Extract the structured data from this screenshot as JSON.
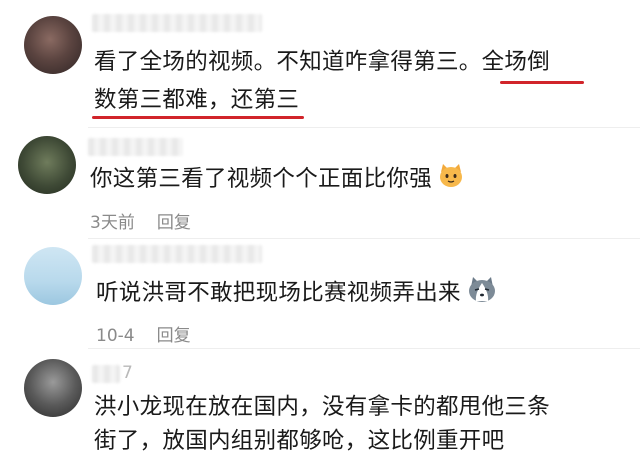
{
  "comments": [
    {
      "line1": "看了全场的视频。不知道咋拿得第三。全场倒",
      "line2": "数第三都难，还第三"
    },
    {
      "line1": "你这第三看了视频个个正面比你强",
      "emoji": "cat-face-emoji",
      "time": "3天前",
      "reply": "回复"
    },
    {
      "line1": "听说洪哥不敢把现场比赛视频弄出来",
      "emoji": "husky-dog-emoji",
      "time": "10-4",
      "reply": "回复"
    },
    {
      "line1": "洪小龙现在放在国内，没有拿卡的都甩他三条",
      "line2": "街了，放国内组别都够呛，这比例重开吧",
      "username_fragment": "7"
    }
  ],
  "colors": {
    "underline": "#d1242a",
    "meta": "#8a8a8a",
    "text": "#1a1a1a"
  }
}
